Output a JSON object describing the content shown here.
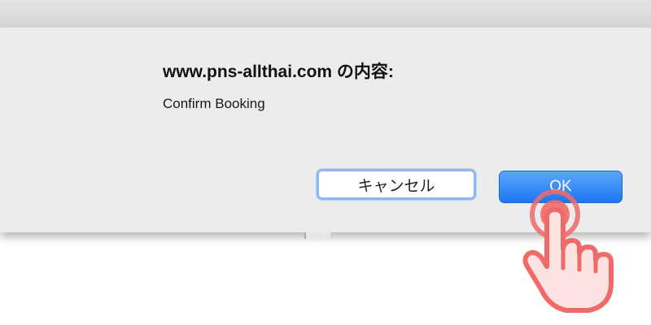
{
  "dialog": {
    "title": "www.pns-allthai.com の内容:",
    "message": "Confirm Booking",
    "cancel_label": "キャンセル",
    "ok_label": "OK"
  },
  "colors": {
    "dialog_background": "#ececec",
    "ok_button": "#1c76f2",
    "cancel_focus_ring": "#8db8f2",
    "tap_indicator": "#f06a6a"
  },
  "icons": {
    "tap_indicator": "pointing-hand-icon"
  }
}
